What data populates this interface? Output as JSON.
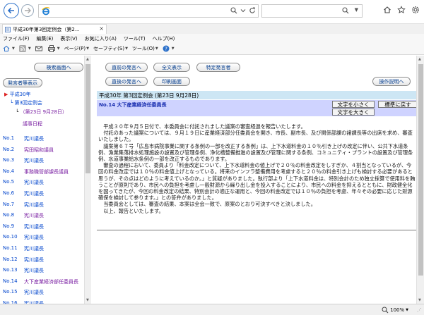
{
  "browser": {
    "tab_title": "平成30年第3回定例会（第2...",
    "menu": [
      "ファイル(F)",
      "編集(E)",
      "表示(V)",
      "お気に入り(A)",
      "ツール(T)",
      "ヘルプ(H)"
    ],
    "cmd": {
      "page": "ページ(P)",
      "safety": "セーフティ(S)",
      "tools": "ツール(O)"
    },
    "zoom": "100%"
  },
  "left": {
    "btn_search_screen": "検索画面へ",
    "btn_speaker_display": "発言者等表示",
    "tree": {
      "year": "平成30年",
      "session": "第3回定例会",
      "date": "（第23日 9月28日）",
      "agenda": "議事日程"
    },
    "speakers": [
      {
        "no": "No.1",
        "name": "宪川議長"
      },
      {
        "no": "No.2",
        "name": "宪田昭和議員"
      },
      {
        "no": "No.3",
        "name": "宪川議長"
      },
      {
        "no": "No.4",
        "name": "事務職管部課長議員"
      },
      {
        "no": "No.5",
        "name": "宪川議長"
      },
      {
        "no": "No.6",
        "name": "宪川議長"
      },
      {
        "no": "No.7",
        "name": "宪川議長"
      },
      {
        "no": "No.8",
        "name": "宪川議長"
      },
      {
        "no": "No.9",
        "name": "宪川議長"
      },
      {
        "no": "No.10",
        "name": "宪川議長"
      },
      {
        "no": "No.11",
        "name": "宪川議長"
      },
      {
        "no": "No.12",
        "name": "宪川議長"
      },
      {
        "no": "No.13",
        "name": "宪川議長"
      },
      {
        "no": "No.14",
        "name": "大下産業経済部任委員長"
      },
      {
        "no": "No.15",
        "name": "宪川議長"
      },
      {
        "no": "No.16",
        "name": "宪川議長"
      }
    ]
  },
  "right": {
    "btn_prev": "直前の発言へ",
    "btn_all": "全文表示",
    "btn_specific": "特定発言者",
    "btn_next": "直後の発言へ",
    "btn_print": "印刷画面",
    "btn_help": "操作説明へ",
    "title": "平成30年 第3回定例会 (第23日 9月28日)",
    "speaker": "No.14 大下産業経済任委員長",
    "btn_smaller": "文字を小さく",
    "btn_standard": "標準に戻す",
    "btn_larger": "文字を大きく",
    "body": "　平成３０年９月５日付で、本委員会に付託されました議案の審査経過を報告いたします。\n　付託のあった議案については、９月１９日に産業経済部分任委員会を開き、市長、副市長、及び関係部課の諸課長等の出席を求め、審査いたしました。\n　議案第６７号「広島市病院事業に関する条例の一部を改正する条例」は、上下水道料金の１０％引き上げの改定に伴い、公共下水道条例、漁業集落排水処理施設の設置及び管理条例、浄化槽整備推進の設置及び管理に関する条例、コミュニティ・プラントの設置及び管理条例、水道事業給水条例の一部を改正するものであります。\n　審査の過程において、委員より「料金改定について、上下水道料金の値上げで２０％の料金改定をしすぎか、４割当となっているが、今回の料金改定では１０％の料金値上げとなっている。将来のインフラ整備費用を考慮すると２０％の料金引き上げも検討する必要があると思うが、その点はどのように考えているのか。」と質疑がありました。執行部より「上下水道料金は、特別会計のため独立採算で使用料を賄うことが原則であり、市民への負担を考慮し一般財源から繰り出し金を投入することにより、市民への料金を抑えるとともに、財政健全化を図ってきたが、今回の料金改定の結果、特別会計の適正な運用と、今回の料金改定では１０％の負担を考慮、年々その必要に応じた財源確保を検討して参ります。」との答弁がありました。\n　当委員会としては、審査の結果、本案は全会一致で、原案のとおり可決すべきと決しました。\n　以上、報告といたします。"
  }
}
